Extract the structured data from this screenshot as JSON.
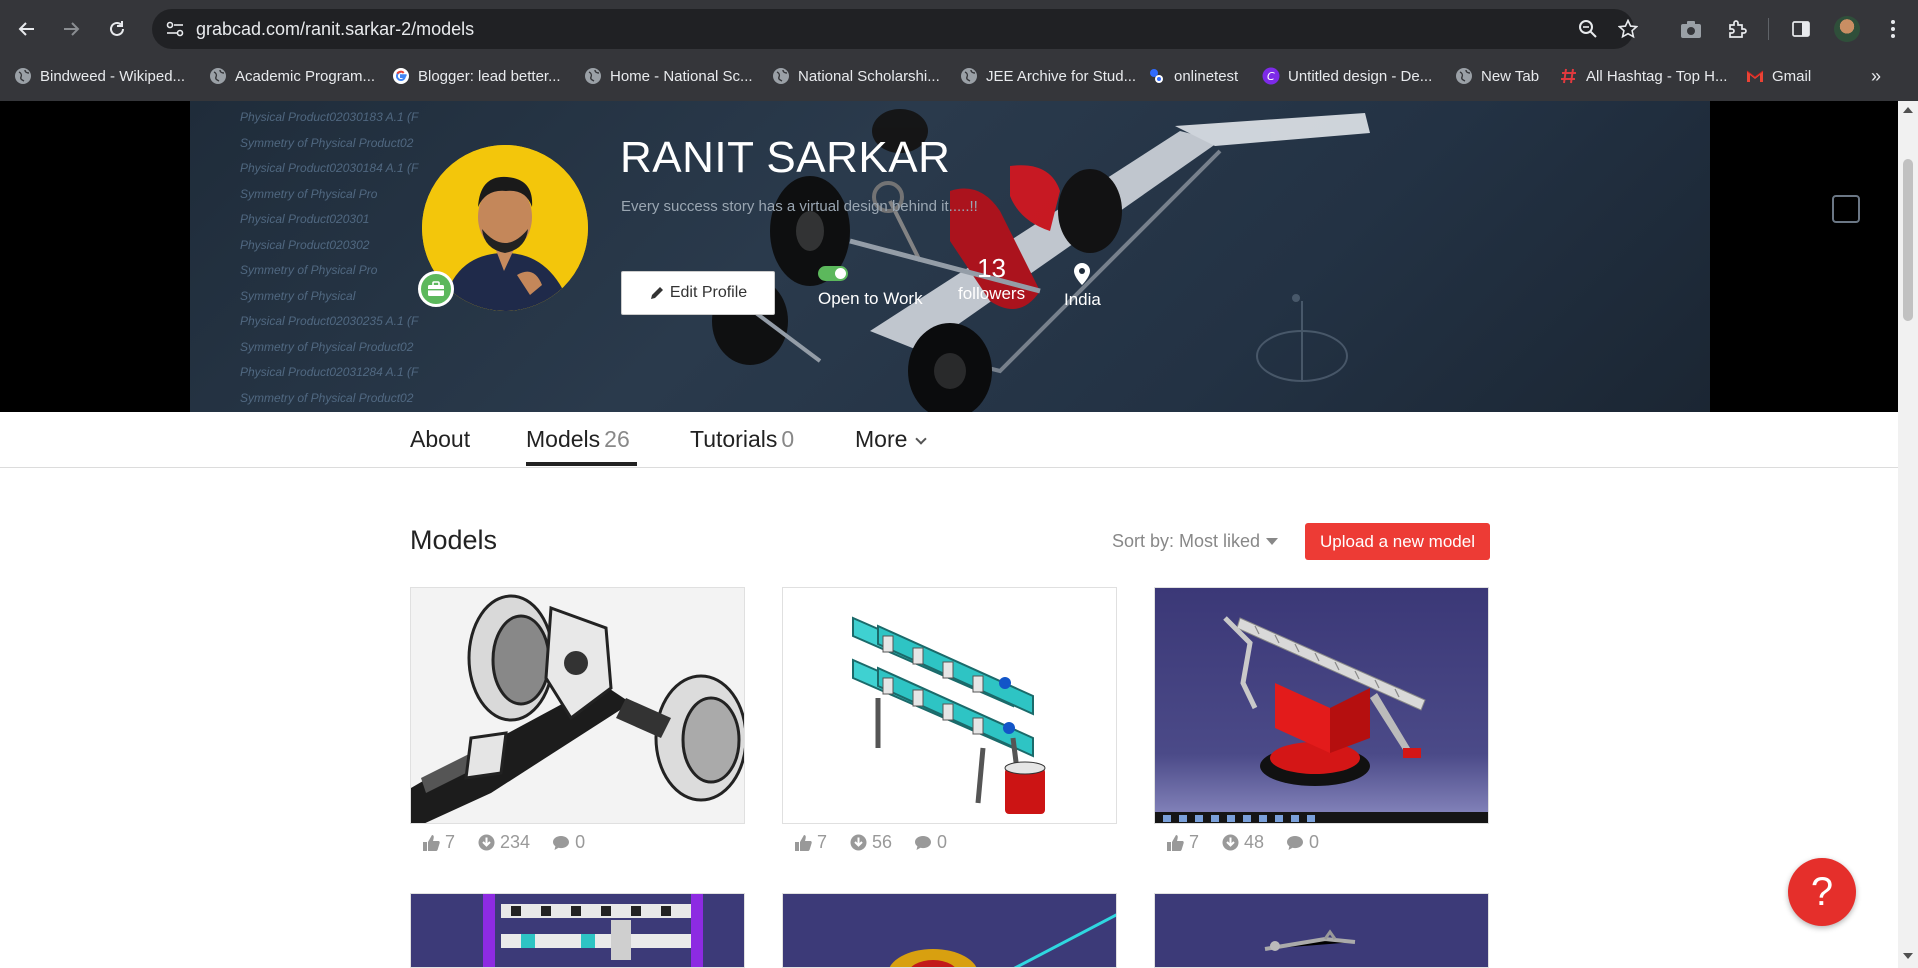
{
  "browser": {
    "url": "grabcad.com/ranit.sarkar-2/models",
    "bookmarks": [
      {
        "label": "Bindweed - Wikiped...",
        "icon": "globe-icon"
      },
      {
        "label": "Academic Program...",
        "icon": "globe-icon"
      },
      {
        "label": "Blogger: lead better...",
        "icon": "google-icon"
      },
      {
        "label": "Home - National Sc...",
        "icon": "globe-icon"
      },
      {
        "label": "National Scholarshi...",
        "icon": "globe-icon"
      },
      {
        "label": "JEE Archive for Stud...",
        "icon": "globe-icon"
      },
      {
        "label": "onlinetest",
        "icon": "onlinetest-icon"
      },
      {
        "label": "Untitled design - De...",
        "icon": "canva-icon"
      },
      {
        "label": "New Tab",
        "icon": "globe-icon"
      },
      {
        "label": "All Hashtag - Top H...",
        "icon": "hashtag-icon"
      },
      {
        "label": "Gmail",
        "icon": "gmail-icon"
      }
    ]
  },
  "profile": {
    "name": "RANIT SARKAR",
    "tagline": "Every success story has a virtual design behind it.....!!",
    "edit_label": "Edit Profile",
    "open_to_work_label": "Open to Work",
    "followers_count": "13",
    "followers_label": "followers",
    "location": "India",
    "banner_tree": [
      "Physical Product02030183 A.1 (F",
      "Symmetry of Physical Product02",
      "Physical Product02030184 A.1 (F",
      "Symmetry of Physical Pro",
      "Physical Product020301",
      "Physical Product020302",
      "Symmetry of Physical Pro",
      "Symmetry of Physical",
      "Physical Product02030235 A.1 (F",
      "Symmetry of Physical Product02",
      "Physical Product02031284 A.1 (F",
      "Symmetry of Physical Product02"
    ]
  },
  "tabs": [
    {
      "label": "About",
      "count": ""
    },
    {
      "label": "Models",
      "count": "26"
    },
    {
      "label": "Tutorials",
      "count": "0"
    },
    {
      "label": "More",
      "count": ""
    }
  ],
  "models_section": {
    "heading": "Models",
    "sort_label": "Sort by: Most liked",
    "upload_label": "Upload a new model",
    "cards": [
      {
        "likes": "7",
        "downloads": "234",
        "comments": "0"
      },
      {
        "likes": "7",
        "downloads": "56",
        "comments": "0"
      },
      {
        "likes": "7",
        "downloads": "48",
        "comments": "0"
      }
    ]
  },
  "help_label": "?",
  "colors": {
    "accent_red": "#ed3b35",
    "open_to_work_green": "#5cb85c",
    "avatar_yellow": "#f3c60b",
    "chrome_bg": "#35363a"
  }
}
